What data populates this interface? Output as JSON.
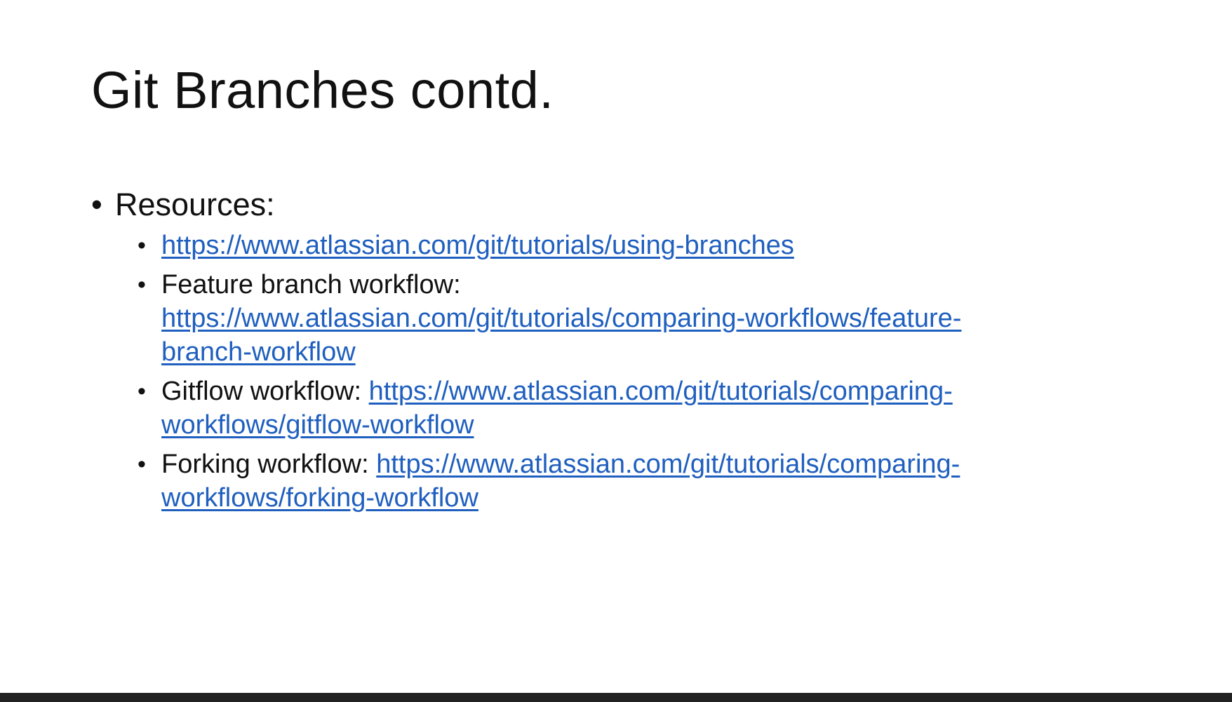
{
  "slide": {
    "title": "Git Branches contd.",
    "resources_label": "Resources:",
    "items": [
      {
        "prefix": "",
        "link": "https://www.atlassian.com/git/tutorials/using-branches"
      },
      {
        "prefix": "Feature branch workflow:",
        "link": "https://www.atlassian.com/git/tutorials/comparing-workflows/feature-branch-workflow"
      },
      {
        "prefix": "Gitflow workflow: ",
        "link": "https://www.atlassian.com/git/tutorials/comparing-workflows/gitflow-workflow"
      },
      {
        "prefix": "Forking workflow: ",
        "link": "https://www.atlassian.com/git/tutorials/comparing-workflows/forking-workflow"
      }
    ]
  },
  "colors": {
    "link": "#1f5fbf",
    "text": "#111111",
    "background": "#ffffff",
    "bottom_bar": "#222222"
  }
}
